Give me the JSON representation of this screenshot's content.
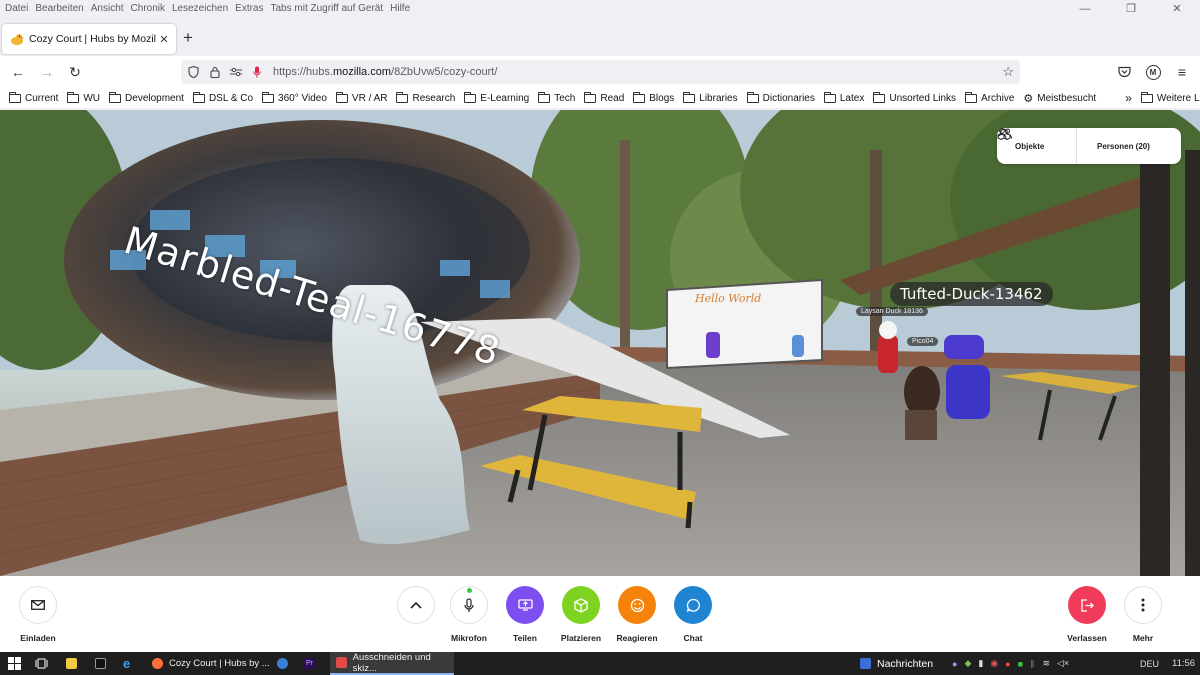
{
  "menu": [
    "Datei",
    "Bearbeiten",
    "Ansicht",
    "Chronik",
    "Lesezeichen",
    "Extras",
    "Tabs mit Zugriff auf Gerät",
    "Hilfe"
  ],
  "window_controls": {
    "minimize": "—",
    "restore": "❐",
    "close": "✕"
  },
  "tab": {
    "favicon": "duck-favicon",
    "title": "Cozy Court | Hubs by Mozilla",
    "close": "✕",
    "new_tab": "+"
  },
  "nav": {
    "back": "←",
    "forward": "→",
    "reload": "↻"
  },
  "url": {
    "prefix": "https://hubs.",
    "domain": "mozilla.com",
    "path": "/8ZbUvw5/cozy-court/"
  },
  "toolbar_right": {
    "account_initial": "M",
    "menu": "≡"
  },
  "bookmarks": {
    "items": [
      "Current",
      "WU",
      "Development",
      "DSL & Co",
      "360° Video",
      "VR / AR",
      "Research",
      "E-Learning",
      "Tech",
      "Read",
      "Blogs",
      "Libraries",
      "Dictionaries",
      "Latex",
      "Unsorted Links",
      "Archive"
    ],
    "most_visited": "Meistbesucht",
    "overflow": "»",
    "more": "Weitere Lesezeichen"
  },
  "scene": {
    "nametag_marbled": "Marbled-Teal-16778",
    "nametag_tufted": "Tufted-Duck-13462",
    "whiteboard_title": "Hello World",
    "small_tags": [
      "Laysan Duck 18136",
      "Pico04"
    ],
    "top_buttons": {
      "objects": "Objekte",
      "people": "Personen (20)"
    }
  },
  "hubs_toolbar": {
    "invite": "Einladen",
    "microphone": "Mikrofon",
    "share": "Teilen",
    "place": "Platzieren",
    "react": "Reagieren",
    "chat": "Chat",
    "leave": "Verlassen",
    "more": "Mehr"
  },
  "colors": {
    "share": "#7d4ff0",
    "place": "#7ed321",
    "react": "#f5820a",
    "chat": "#1f85d2",
    "leave": "#f03c5a"
  },
  "taskbar": {
    "apps": [
      "Cozy Court | Hubs by ...",
      "Ausschneiden und skiz..."
    ],
    "news": "Nachrichten",
    "lang": "DEU",
    "time": "11:56"
  }
}
